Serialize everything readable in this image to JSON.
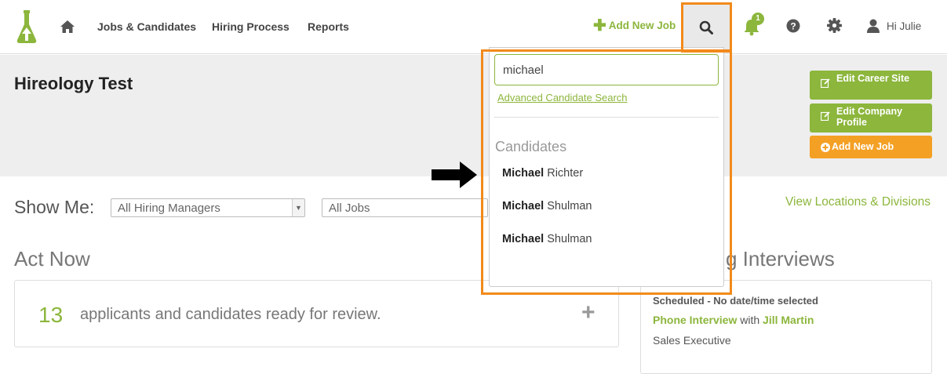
{
  "nav": {
    "links": [
      "Jobs & Candidates",
      "Hiring Process",
      "Reports"
    ],
    "add_job": "Add New Job",
    "notification_count": "1",
    "user_greeting": "Hi Julie"
  },
  "header": {
    "company": "Hireology Test",
    "buttons": [
      "Edit Career Site",
      "Edit Company Profile",
      "Add New Job"
    ]
  },
  "filters": {
    "label": "Show Me:",
    "managers": "All Hiring Managers",
    "jobs": "All Jobs",
    "view_locations": "View Locations & Divisions"
  },
  "act_now": {
    "heading": "Act Now",
    "count": "13",
    "text": "applicants and candidates ready for review."
  },
  "interviews": {
    "heading": "g Interviews",
    "status": "Scheduled - No date/time selected",
    "type": "Phone Interview",
    "with": "with",
    "person": "Jill Martin",
    "job": "Sales Executive"
  },
  "search": {
    "query": "michael",
    "advanced": "Advanced Candidate Search",
    "heading": "Candidates",
    "results": [
      {
        "first": "Michael",
        "last": "Richter"
      },
      {
        "first": "Michael",
        "last": "Shulman"
      },
      {
        "first": "Michael",
        "last": "Shulman"
      }
    ]
  },
  "colors": {
    "brand_green": "#8cb63c",
    "accent_orange": "#f4a024",
    "highlight": "#f28a1b"
  }
}
